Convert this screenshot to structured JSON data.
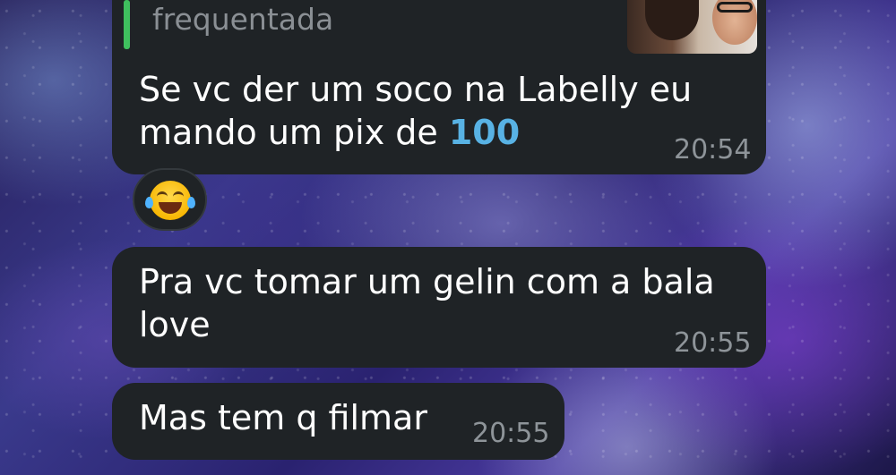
{
  "chat": {
    "messages": [
      {
        "reply_preview_text": "frequentada",
        "text_line1": "Se vc der um soco na Labelly eu",
        "text_line2_prefix": "mando um pix de ",
        "text_line2_link": "100",
        "time": "20:54",
        "reaction_icon": "face-with-tears-of-joy-emoji"
      },
      {
        "text_line1": "Pra vc tomar um gelin com a bala",
        "text_line2": "love",
        "time": "20:55"
      },
      {
        "text_line1": "Mas tem q filmar",
        "time": "20:55"
      }
    ]
  },
  "colors": {
    "bubble": "#1f2326",
    "reply_accent": "#3fbf5e",
    "link": "#58b2e4",
    "timestamp": "#8e9499"
  }
}
